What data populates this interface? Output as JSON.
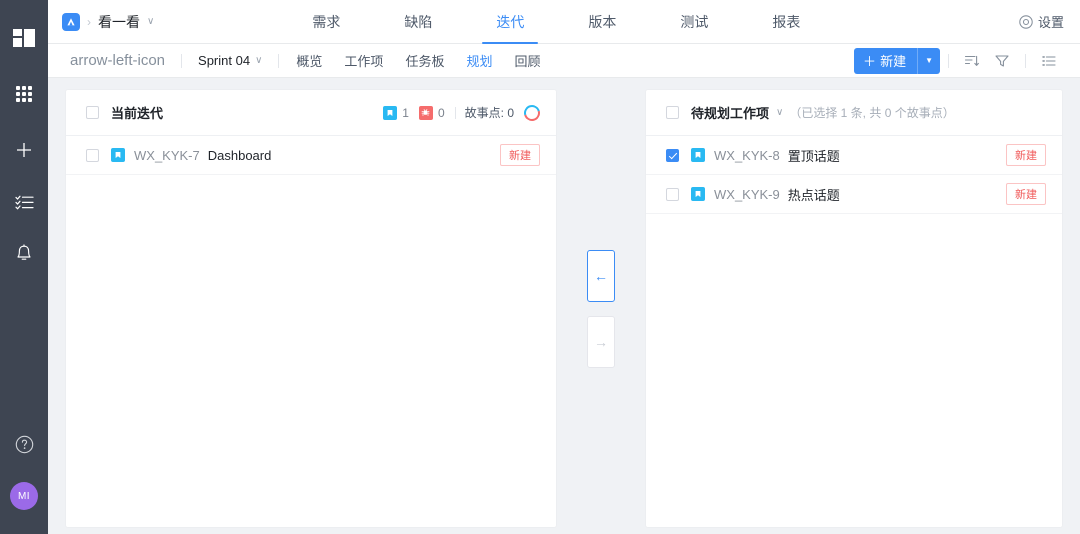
{
  "rail": {
    "items": [
      {
        "name": "workspace-logo",
        "icon": "grid-logo-icon"
      },
      {
        "name": "apps",
        "icon": "apps-grid-icon"
      },
      {
        "name": "create",
        "icon": "plus-icon"
      },
      {
        "name": "tasks",
        "icon": "checklist-icon"
      },
      {
        "name": "notifications",
        "icon": "bell-icon"
      }
    ],
    "help_icon": "question-circle-icon",
    "avatar_text": "MI"
  },
  "topbar": {
    "logo_icon": "product-logo-icon",
    "breadcrumb_separator": "›",
    "project_name": "看一看",
    "project_caret": "∨",
    "tabs": [
      {
        "label": "需求",
        "active": false
      },
      {
        "label": "缺陷",
        "active": false
      },
      {
        "label": "迭代",
        "active": true
      },
      {
        "label": "版本",
        "active": false
      },
      {
        "label": "测试",
        "active": false
      },
      {
        "label": "报表",
        "active": false
      }
    ],
    "settings_label": "设置",
    "settings_icon": "gear-circle-icon"
  },
  "subbar": {
    "back_icon": "arrow-left-icon",
    "sprint_label": "Sprint 04",
    "sprint_caret": "∨",
    "tabs": [
      {
        "label": "概览",
        "active": false
      },
      {
        "label": "工作项",
        "active": false
      },
      {
        "label": "任务板",
        "active": false
      },
      {
        "label": "规划",
        "active": true
      },
      {
        "label": "回顾",
        "active": false
      }
    ],
    "new_button": {
      "plus": "＋",
      "label": "新建",
      "caret": "▼"
    },
    "tools": [
      {
        "name": "sort-icon"
      },
      {
        "name": "filter-icon"
      },
      {
        "name": "list-view-icon"
      }
    ]
  },
  "left_panel": {
    "header": {
      "title": "当前迭代",
      "checked": false,
      "story_count": "1",
      "bug_count": "0",
      "story_points_label": "故事点: 0"
    },
    "rows": [
      {
        "checked": false,
        "icon": "story-icon",
        "key": "WX_KYK-7",
        "title": "Dashboard",
        "status": "新建"
      }
    ]
  },
  "transfer": {
    "move_left": {
      "glyph": "←",
      "enabled": true
    },
    "move_right": {
      "glyph": "→",
      "enabled": false
    }
  },
  "right_panel": {
    "header": {
      "title": "待规划工作项",
      "caret": "∨",
      "checked": false,
      "summary": "（已选择 1 条, 共 0 个故事点）"
    },
    "rows": [
      {
        "checked": true,
        "icon": "story-icon",
        "key": "WX_KYK-8",
        "title": "置顶话题",
        "status": "新建"
      },
      {
        "checked": false,
        "icon": "story-icon",
        "key": "WX_KYK-9",
        "title": "热点话题",
        "status": "新建"
      }
    ]
  },
  "colors": {
    "accent": "#3b8cf5",
    "story": "#29b9f2",
    "bug": "#f56c6c",
    "status_text": "#f05a5a",
    "rail_bg": "#3e4552",
    "avatar_bg": "#9b6ae8",
    "page_bg": "#f0f2f5"
  }
}
